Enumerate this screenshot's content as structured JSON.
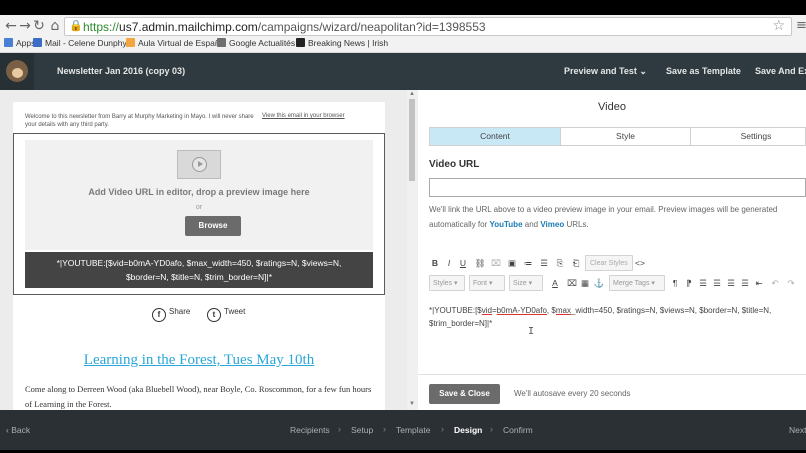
{
  "browser": {
    "url_scheme": "https://",
    "url_host": "us7.admin.mailchimp.com",
    "url_path": "/campaigns/wizard/neapolitan?id=1398553",
    "bookmarks": [
      "Apps",
      "Mail - Celene Dunphy",
      "Aula Virtual de Españ",
      "Google Actualités",
      "Breaking News | Irish"
    ]
  },
  "header": {
    "campaign_title": "Newsletter Jan 2016 (copy 03)",
    "preview_test": "Preview and Test",
    "save_template": "Save as Template",
    "save_exit": "Save And Exi"
  },
  "email": {
    "preheader": "Welcome to this newsletter from Barry at Murphy Marketing in Mayo. I will never share your details with any third party.",
    "view_browser": "View this email in your browser",
    "add_video_text": "Add Video URL in editor, drop a preview image here",
    "or_text": "or",
    "browse_label": "Browse",
    "merge_line1": "*|YOUTUBE:[$vid=b0mA-YD0afo, $max_width=450, $ratings=N, $views=N,",
    "merge_line2": "$border=N, $title=N, $trim_border=N]|*",
    "share_label": "Share",
    "tweet_label": "Tweet",
    "headline": "Learning in the Forest, Tues May 10th",
    "body": "Come along to Derreen Wood (aka Bluebell Wood), near Boyle, Co. Roscommon, for a few fun hours of Learning in the Forest."
  },
  "panel": {
    "title": "Video",
    "tabs": [
      "Content",
      "Style",
      "Settings"
    ],
    "active_tab": "Content",
    "video_url_label": "Video URL",
    "video_url_value": "",
    "help_part1": "We'll link the URL above to a video preview image in your email. Preview images will be generated",
    "help_part2": "automatically for",
    "help_youtube": "YouTube",
    "help_and": "and",
    "help_vimeo": "Vimeo",
    "help_end": "URLs.",
    "toolbar_row1": [
      "B",
      "I",
      "U",
      "⛓",
      "⌧",
      "▣",
      "≔",
      "☰",
      "⎘",
      "⎗"
    ],
    "clear_styles": "Clear Styles",
    "code_view": "<>",
    "dropdowns": [
      "Styles",
      "Font",
      "Size"
    ],
    "merge_tags": "Merge Tags",
    "editor_content_a": "*|YOUTUBE:[$",
    "editor_content_vid": "vid",
    "editor_content_b": "=",
    "editor_content_id": "b0mA-YD0afo",
    "editor_content_c": ", $",
    "editor_content_max": "max",
    "editor_content_d": "_width=450, $ratings=N, $views=N, $border=N, $title=N,",
    "editor_content_line2": "$trim_border=N]|*",
    "save_close": "Save & Close",
    "autosave": "We'll autosave every 20 seconds"
  },
  "footer": {
    "back": "Back",
    "steps": [
      "Recipients",
      "Setup",
      "Template",
      "Design",
      "Confirm"
    ],
    "active_step": "Design",
    "next": "Next"
  },
  "colors": {
    "accent": "#2aa7d8",
    "active_tab": "#c9e8f5",
    "appbar": "#2f3a40",
    "bottombar": "#2b3034"
  }
}
